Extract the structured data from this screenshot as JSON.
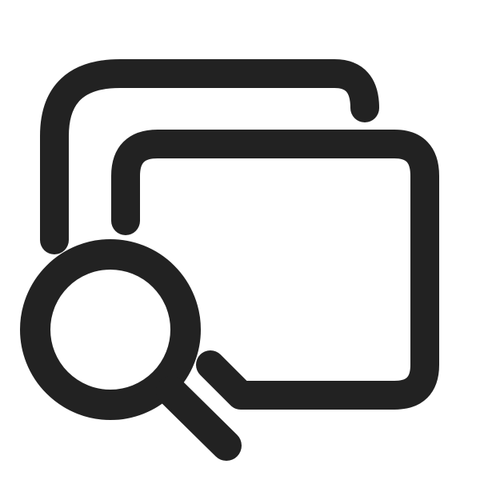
{
  "icon": {
    "name": "search-multiple-windows-icon",
    "stroke_color": "#222222",
    "background_color": "#ffffff"
  }
}
